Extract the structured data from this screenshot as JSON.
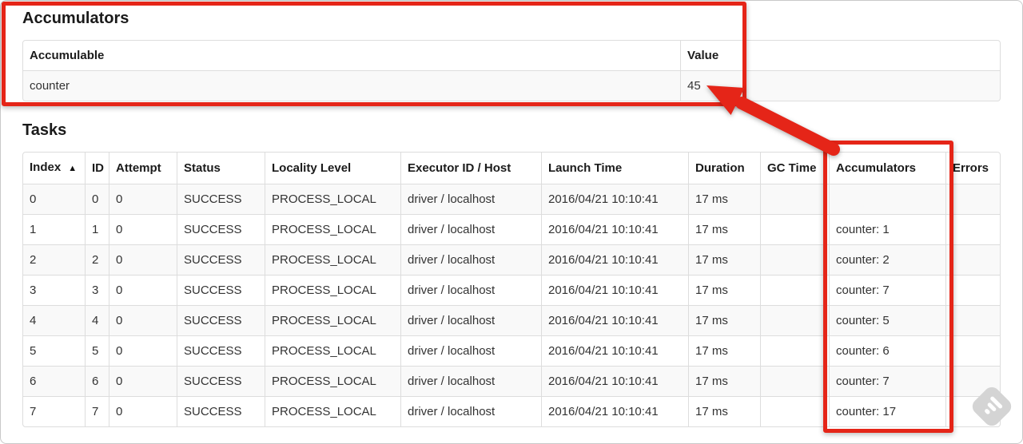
{
  "annotations": {
    "highlight_color": "#e52518"
  },
  "icons": {
    "sort_ascending": "▲",
    "watermark": "skitch-diamond-logo"
  },
  "accumulators_section": {
    "title": "Accumulators",
    "table": {
      "sortable": false,
      "headers": [
        "Accumulable",
        "Value"
      ],
      "rows": [
        [
          "counter",
          "45"
        ]
      ]
    }
  },
  "tasks_section": {
    "title": "Tasks",
    "table": {
      "sortable": true,
      "sorted_column": 0,
      "sort_icon": "▲",
      "headers": [
        "Index",
        "ID",
        "Attempt",
        "Status",
        "Locality Level",
        "Executor ID / Host",
        "Launch Time",
        "Duration",
        "GC Time",
        "Accumulators",
        "Errors"
      ],
      "rows": [
        [
          "0",
          "0",
          "0",
          "SUCCESS",
          "PROCESS_LOCAL",
          "driver / localhost",
          "2016/04/21 10:10:41",
          "17 ms",
          "",
          "",
          ""
        ],
        [
          "1",
          "1",
          "0",
          "SUCCESS",
          "PROCESS_LOCAL",
          "driver / localhost",
          "2016/04/21 10:10:41",
          "17 ms",
          "",
          "counter: 1",
          ""
        ],
        [
          "2",
          "2",
          "0",
          "SUCCESS",
          "PROCESS_LOCAL",
          "driver / localhost",
          "2016/04/21 10:10:41",
          "17 ms",
          "",
          "counter: 2",
          ""
        ],
        [
          "3",
          "3",
          "0",
          "SUCCESS",
          "PROCESS_LOCAL",
          "driver / localhost",
          "2016/04/21 10:10:41",
          "17 ms",
          "",
          "counter: 7",
          ""
        ],
        [
          "4",
          "4",
          "0",
          "SUCCESS",
          "PROCESS_LOCAL",
          "driver / localhost",
          "2016/04/21 10:10:41",
          "17 ms",
          "",
          "counter: 5",
          ""
        ],
        [
          "5",
          "5",
          "0",
          "SUCCESS",
          "PROCESS_LOCAL",
          "driver / localhost",
          "2016/04/21 10:10:41",
          "17 ms",
          "",
          "counter: 6",
          ""
        ],
        [
          "6",
          "6",
          "0",
          "SUCCESS",
          "PROCESS_LOCAL",
          "driver / localhost",
          "2016/04/21 10:10:41",
          "17 ms",
          "",
          "counter: 7",
          ""
        ],
        [
          "7",
          "7",
          "0",
          "SUCCESS",
          "PROCESS_LOCAL",
          "driver / localhost",
          "2016/04/21 10:10:41",
          "17 ms",
          "",
          "counter: 17",
          ""
        ]
      ]
    }
  }
}
